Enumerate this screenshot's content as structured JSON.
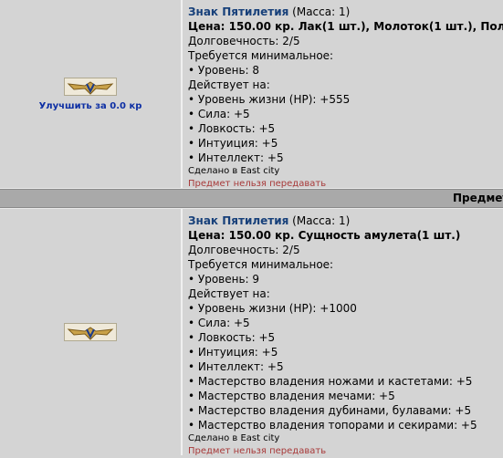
{
  "items": [
    {
      "name": "Знак Пятилетия",
      "mass": "(Масса: 1)",
      "price": "Цена: 150.00 кр. Лак(1 шт.), Молоток(1 шт.), Пол",
      "durability": "Долговечность: 2/5",
      "requires_label": "Требуется минимальное:",
      "requirements": [
        "• Уровень: 8"
      ],
      "effects_label": "Действует на:",
      "effects": [
        "• Уровень жизни (HP): +555",
        "• Сила: +5",
        "• Ловкость: +5",
        "• Интуиция: +5",
        "• Интеллект: +5"
      ],
      "made_in": "Сделано в East city",
      "no_transfer": "Предмет нельзя передавать",
      "upgrade_label": "Улучшить за 0.0 кр"
    },
    {
      "name": "Знак Пятилетия",
      "mass": "(Масса: 1)",
      "price": "Цена: 150.00 кр. Сущность амулета(1 шт.)",
      "durability": "Долговечность: 2/5",
      "requires_label": "Требуется минимальное:",
      "requirements": [
        "• Уровень: 9"
      ],
      "effects_label": "Действует на:",
      "effects": [
        "• Уровень жизни (HP): +1000",
        "• Сила: +5",
        "• Ловкость: +5",
        "• Интуиция: +5",
        "• Интеллект: +5",
        "• Мастерство владения ножами и кастетами: +5",
        "• Мастерство владения мечами: +5",
        "• Мастерство владения дубинами, булавами: +5",
        "• Мастерство владения топорами и секирами: +5"
      ],
      "made_in": "Сделано в East city",
      "no_transfer": "Предмет нельзя передавать"
    }
  ],
  "separator_label": "Предмет",
  "icons": {
    "item": "five-year-badge-icon"
  },
  "colors": {
    "name": "#17407a",
    "upgrade": "#0d2fa4",
    "no_transfer": "#a83a3a",
    "separator": "#a9a9a9"
  }
}
